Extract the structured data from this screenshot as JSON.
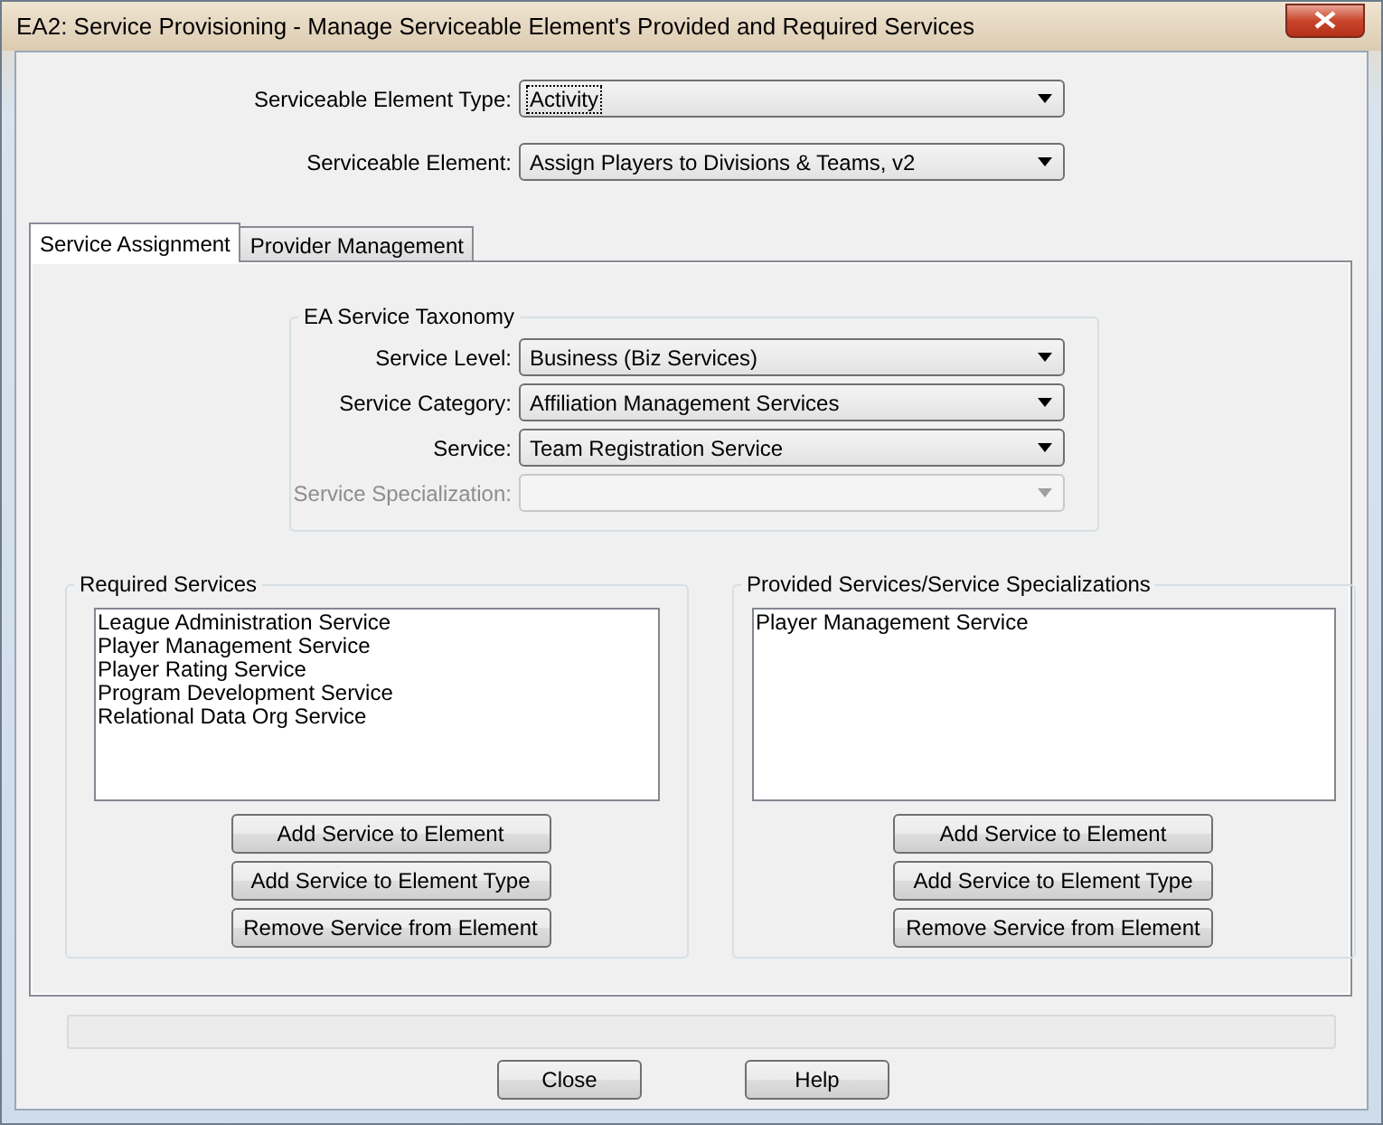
{
  "window": {
    "title": "EA2: Service Provisioning - Manage Serviceable Element's Provided and Required Services"
  },
  "top_fields": [
    {
      "label": "Serviceable Element Type:",
      "value": "Activity",
      "focused": true
    },
    {
      "label": "Serviceable Element:",
      "value": "Assign Players to Divisions & Teams, v2",
      "focused": false
    }
  ],
  "tabs": [
    {
      "label": "Service Assignment",
      "selected": true
    },
    {
      "label": "Provider Management",
      "selected": false
    }
  ],
  "taxonomy": {
    "title": "EA Service Taxonomy",
    "fields": [
      {
        "label": "Service Level:",
        "value": "Business (Biz Services)",
        "disabled": false
      },
      {
        "label": "Service Category:",
        "value": "Affiliation Management Services",
        "disabled": false
      },
      {
        "label": "Service:",
        "value": "Team Registration Service",
        "disabled": false
      },
      {
        "label": "Service Specialization:",
        "disabled": true
      }
    ]
  },
  "groups": [
    {
      "title": "Required Services",
      "items": [
        "League Administration Service",
        "Player Management Service",
        "Player Rating Service",
        "Program Development Service",
        "Relational Data Org Service"
      ],
      "buttons": [
        "Add Service to Element",
        "Add Service to Element Type",
        "Remove Service from Element"
      ]
    },
    {
      "title": "Provided Services/Service Specializations",
      "items": [
        "Player Management Service"
      ],
      "buttons": [
        "Add Service to Element",
        "Add Service to Element Type",
        "Remove Service from Element"
      ]
    }
  ],
  "buttons": [
    "Close",
    "Help"
  ]
}
